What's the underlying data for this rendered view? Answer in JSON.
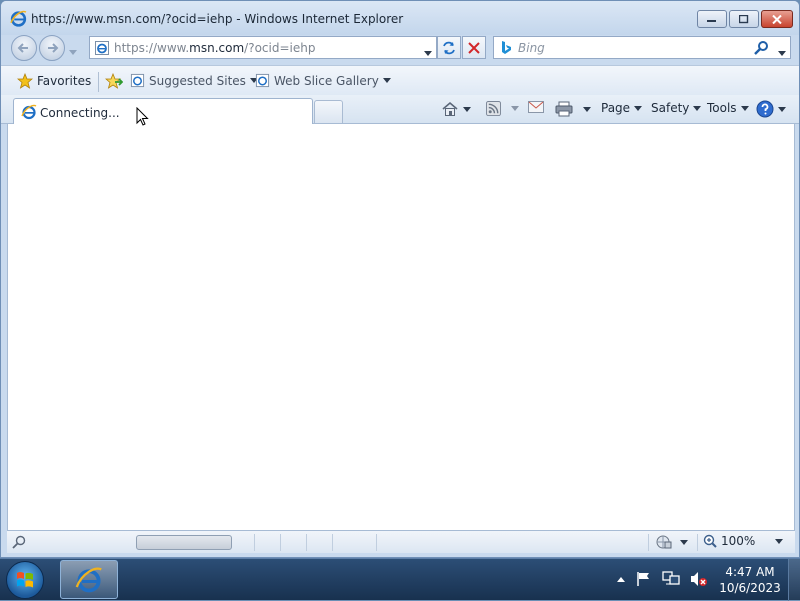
{
  "window": {
    "title": "https://www.msn.com/?ocid=iehp - Windows Internet Explorer"
  },
  "address": {
    "prefix": "https://www.",
    "domain": "msn.com",
    "suffix": "/?ocid=iehp"
  },
  "search": {
    "placeholder": "Bing"
  },
  "favorites_bar": {
    "favorites_label": "Favorites",
    "suggested_sites_label": "Suggested Sites",
    "web_slice_gallery_label": "Web Slice Gallery"
  },
  "tab": {
    "label": "Connecting..."
  },
  "command_bar": {
    "page_label": "Page",
    "safety_label": "Safety",
    "tools_label": "Tools"
  },
  "status_bar": {
    "zoom": "100%"
  },
  "taskbar": {
    "time": "4:47 AM",
    "date": "10/6/2023"
  },
  "icons": {
    "browser": "internet-explorer-icon",
    "home": "home-icon",
    "feeds": "rss-icon",
    "mail": "mail-icon",
    "print": "printer-icon",
    "help": "help-icon",
    "search": "magnifier-icon",
    "refresh": "refresh-icon",
    "stop": "stop-icon"
  },
  "colors": {
    "ie_blue": "#1f6fc5",
    "stop_red": "#d2272a",
    "taskbar": "#1f3b5e"
  }
}
